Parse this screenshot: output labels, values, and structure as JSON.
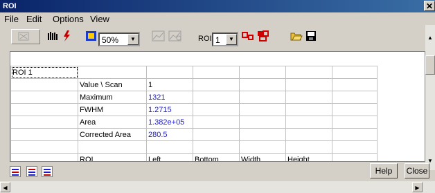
{
  "window": {
    "title": "ROI",
    "close_glyph": "✕"
  },
  "menu": [
    "File",
    "Edit",
    "Options",
    "View"
  ],
  "toolbar": {
    "zoom_value": "50%",
    "roi_label": "ROI",
    "roi_value": "1",
    "icons": [
      "zoom-out-icon",
      "bar-graph-icon",
      "lightning-icon",
      "display-box-icon",
      "line-chart-icon",
      "chart-settings-icon",
      "roi-shapes-icon",
      "roi-shapes-red-icon",
      "open-folder-icon",
      "save-disk-icon"
    ]
  },
  "grid": {
    "rows": [
      [
        "ROI 1",
        "",
        "",
        "",
        "",
        "",
        ""
      ],
      [
        "",
        "Value  \\  Scan",
        "1",
        "",
        "",
        "",
        ""
      ],
      [
        "",
        "Maximum",
        "1321",
        "",
        "",
        "",
        ""
      ],
      [
        "",
        "FWHM",
        "1.2715",
        "",
        "",
        "",
        ""
      ],
      [
        "",
        "Area",
        "1.382e+05",
        "",
        "",
        "",
        ""
      ],
      [
        "",
        "Corrected Area",
        "280.5",
        "",
        "",
        "",
        ""
      ],
      [
        "",
        "",
        "",
        "",
        "",
        "",
        ""
      ],
      [
        "",
        "ROI",
        "Left",
        "Bottom",
        "Width",
        "Height",
        ""
      ]
    ],
    "blue_cells": [
      "2-2",
      "3-2",
      "4-2",
      "5-2"
    ]
  },
  "bottom": {
    "help_label": "Help",
    "close_label": "Close"
  }
}
